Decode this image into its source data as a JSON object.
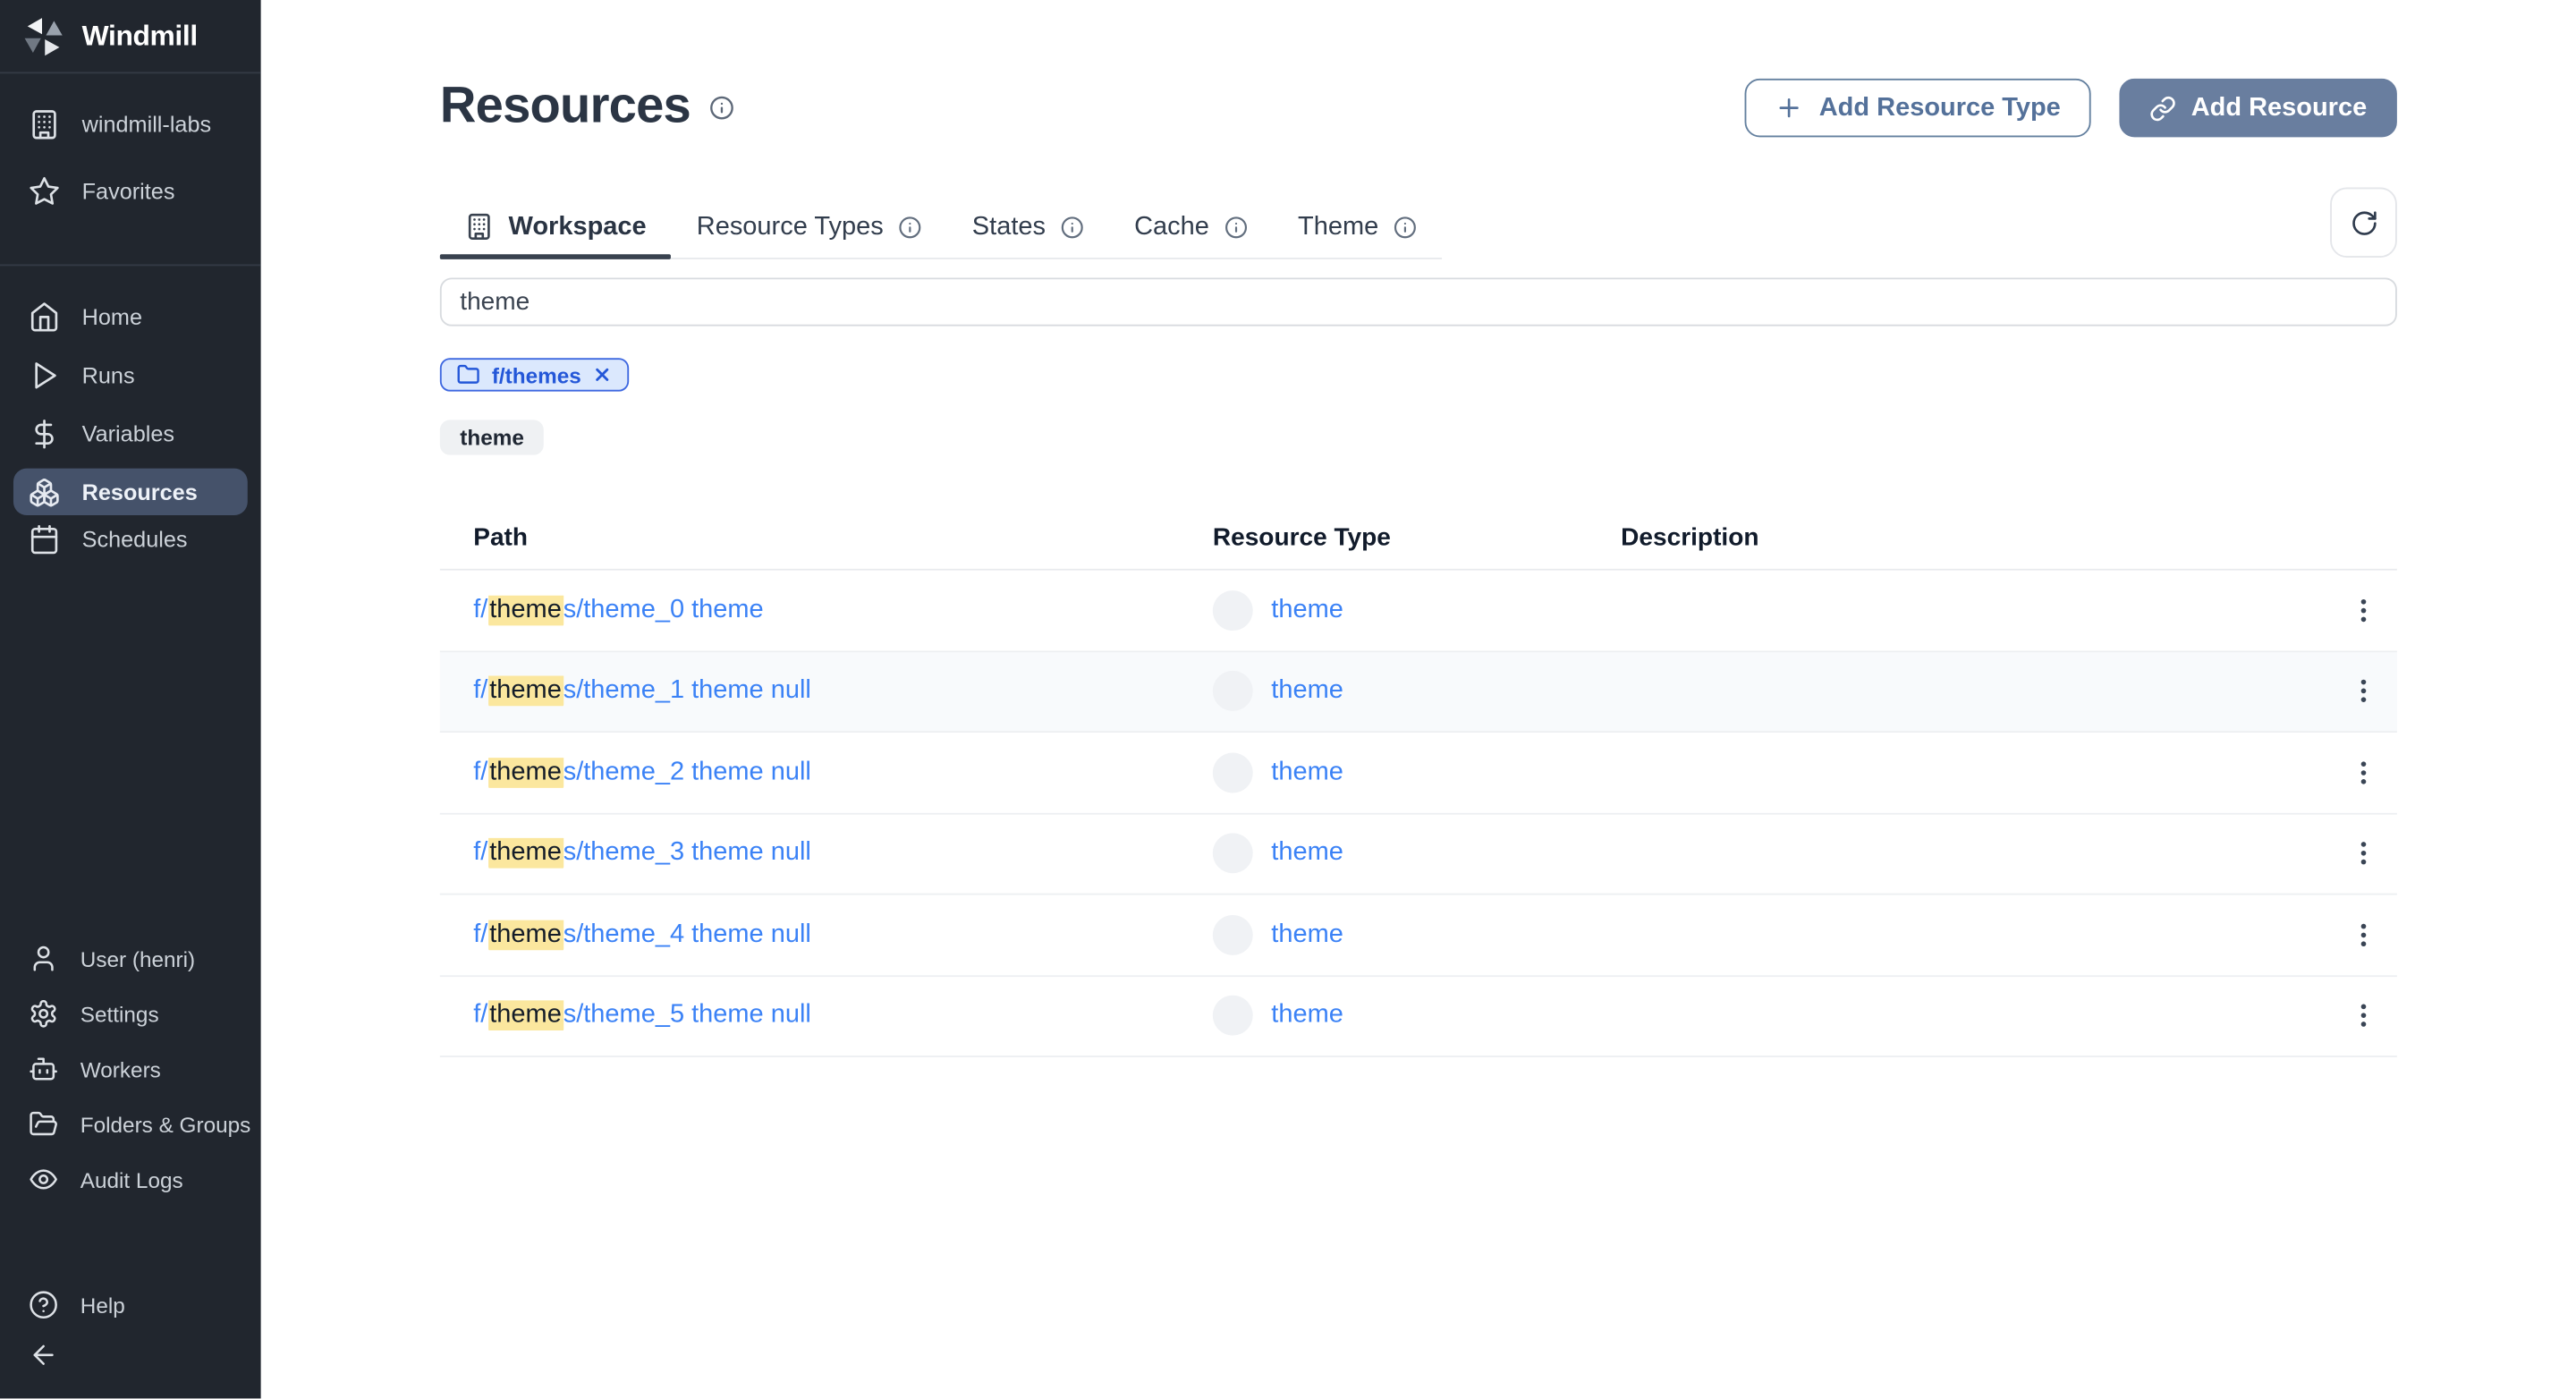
{
  "app": {
    "name": "Windmill"
  },
  "colors": {
    "accent": "#697e9f",
    "link_blue": "#3b82f6",
    "highlight_yellow": "#fbe79e",
    "sidebar_bg": "#21262e",
    "sidebar_active_bg": "#45526a"
  },
  "sidebar": {
    "workspace": {
      "label": "windmill-labs"
    },
    "favorites": {
      "label": "Favorites"
    },
    "nav": [
      {
        "label": "Home"
      },
      {
        "label": "Runs"
      },
      {
        "label": "Variables"
      },
      {
        "label": "Resources",
        "active": true
      },
      {
        "label": "Schedules"
      }
    ],
    "footer": [
      {
        "label": "User (henri)"
      },
      {
        "label": "Settings"
      },
      {
        "label": "Workers"
      },
      {
        "label": "Folders & Groups"
      },
      {
        "label": "Audit Logs"
      }
    ],
    "help": {
      "label": "Help"
    }
  },
  "header": {
    "title": "Resources",
    "add_resource_type_label": "Add Resource Type",
    "add_resource_label": "Add Resource"
  },
  "tabs": [
    {
      "label": "Workspace",
      "active": true
    },
    {
      "label": "Resource Types"
    },
    {
      "label": "States"
    },
    {
      "label": "Cache"
    },
    {
      "label": "Theme"
    }
  ],
  "filters": {
    "search_value": "theme",
    "folder_chip": "f/themes",
    "badge": "theme"
  },
  "table": {
    "columns": [
      "Path",
      "Resource Type",
      "Description"
    ],
    "rows": [
      {
        "path_prefix": "f/",
        "path_highlight": "theme",
        "path_suffix": "s/theme_0 theme",
        "resource_type": "theme",
        "description": "",
        "hovered": false
      },
      {
        "path_prefix": "f/",
        "path_highlight": "theme",
        "path_suffix": "s/theme_1 theme null",
        "resource_type": "theme",
        "description": "",
        "hovered": true
      },
      {
        "path_prefix": "f/",
        "path_highlight": "theme",
        "path_suffix": "s/theme_2 theme null",
        "resource_type": "theme",
        "description": "",
        "hovered": false
      },
      {
        "path_prefix": "f/",
        "path_highlight": "theme",
        "path_suffix": "s/theme_3 theme null",
        "resource_type": "theme",
        "description": "",
        "hovered": false
      },
      {
        "path_prefix": "f/",
        "path_highlight": "theme",
        "path_suffix": "s/theme_4 theme null",
        "resource_type": "theme",
        "description": "",
        "hovered": false
      },
      {
        "path_prefix": "f/",
        "path_highlight": "theme",
        "path_suffix": "s/theme_5 theme null",
        "resource_type": "theme",
        "description": "",
        "hovered": false
      }
    ]
  }
}
